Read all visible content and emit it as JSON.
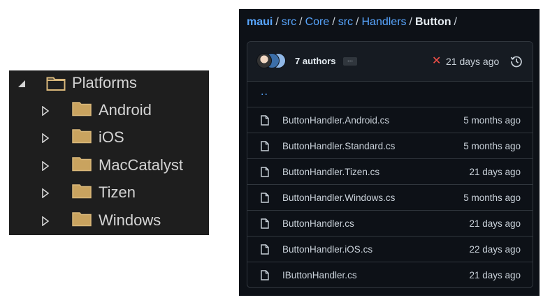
{
  "explorer": {
    "root": {
      "label": "Platforms",
      "expanded": true
    },
    "children": [
      {
        "label": "Android"
      },
      {
        "label": "iOS"
      },
      {
        "label": "MacCatalyst"
      },
      {
        "label": "Tizen"
      },
      {
        "label": "Windows"
      }
    ]
  },
  "repo": {
    "breadcrumb": {
      "parts": [
        "maui",
        "src",
        "Core",
        "src",
        "Handlers"
      ],
      "current": "Button",
      "separator": "/"
    },
    "header": {
      "authors": "7 authors",
      "more_label": "...",
      "status_icon": "x-icon",
      "commit_age": "21 days ago",
      "history_icon": "history-icon"
    },
    "parent_link": "..",
    "files": [
      {
        "name": "ButtonHandler.Android.cs",
        "age": "5 months ago"
      },
      {
        "name": "ButtonHandler.Standard.cs",
        "age": "5 months ago"
      },
      {
        "name": "ButtonHandler.Tizen.cs",
        "age": "21 days ago"
      },
      {
        "name": "ButtonHandler.Windows.cs",
        "age": "5 months ago"
      },
      {
        "name": "ButtonHandler.cs",
        "age": "21 days ago"
      },
      {
        "name": "ButtonHandler.iOS.cs",
        "age": "22 days ago"
      },
      {
        "name": "IButtonHandler.cs",
        "age": "21 days ago"
      }
    ]
  },
  "colors": {
    "explorer_bg": "#1e1e1e",
    "folder": "#c9a35f",
    "repo_bg": "#0d1117",
    "link": "#58a6ff",
    "error": "#f85149"
  }
}
